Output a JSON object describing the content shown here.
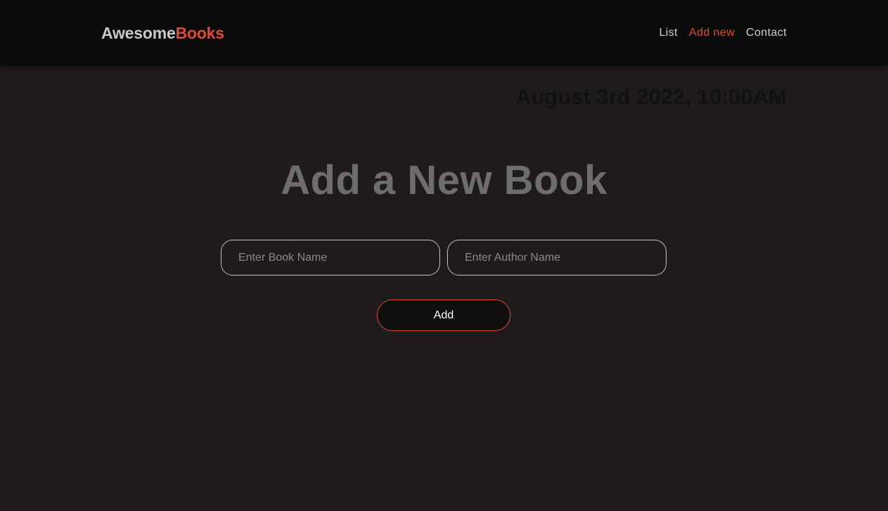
{
  "header": {
    "logo_part1": "Awesome",
    "logo_part2": "Books",
    "nav": [
      {
        "label": "List",
        "active": false
      },
      {
        "label": "Add new",
        "active": true
      },
      {
        "label": "Contact",
        "active": false
      }
    ]
  },
  "date": "August 3rd 2022, 10:00AM",
  "form": {
    "title": "Add a New Book",
    "book_placeholder": "Enter Book Name",
    "author_placeholder": "Enter Author Name",
    "book_value": "",
    "author_value": "",
    "add_label": "Add"
  },
  "colors": {
    "accent": "#e0493c",
    "background": "#1e1b1a",
    "navbar": "#0c0b0b"
  }
}
